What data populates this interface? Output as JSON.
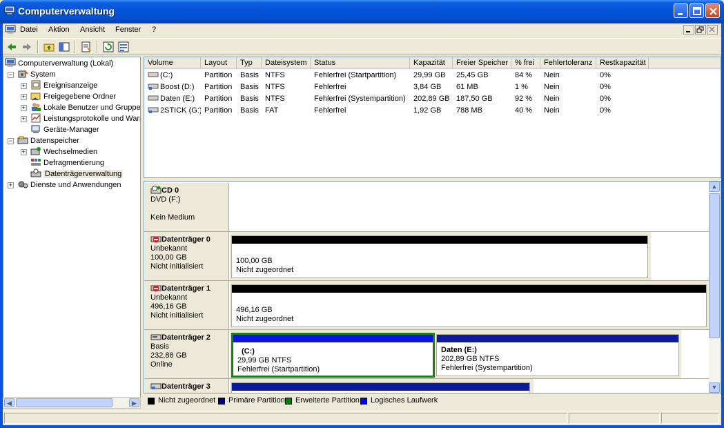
{
  "window": {
    "title": "Computerverwaltung"
  },
  "menu": {
    "items": [
      "Datei",
      "Aktion",
      "Ansicht",
      "Fenster",
      "?"
    ]
  },
  "toolbar": {
    "buttons": [
      "back-icon",
      "forward-icon",
      "up-folder-icon",
      "show-hide-tree-icon",
      "properties-icon",
      "refresh-icon",
      "export-list-icon"
    ]
  },
  "tree": {
    "root": "Computerverwaltung (Lokal)",
    "system": "System",
    "ereignis": "Ereignisanzeige",
    "freigegeben": "Freigegebene Ordner",
    "benutzer": "Lokale Benutzer und Gruppen",
    "leistung": "Leistungsprotokolle und Warnungen",
    "geraete": "Geräte-Manager",
    "datenspeicher": "Datenspeicher",
    "wechselmedien": "Wechselmedien",
    "defrag": "Defragmentierung",
    "datentraeger": "Datenträgerverwaltung",
    "dienste": "Dienste und Anwendungen"
  },
  "list": {
    "columns": [
      "Volume",
      "Layout",
      "Typ",
      "Dateisystem",
      "Status",
      "Kapazität",
      "Freier Speicher",
      "% frei",
      "Fehlertoleranz",
      "Restkapazität"
    ],
    "rows": [
      [
        "(C:)",
        "Partition",
        "Basis",
        "NTFS",
        "Fehlerfrei (Startpartition)",
        "29,99 GB",
        "25,45 GB",
        "84 %",
        "Nein",
        "0%"
      ],
      [
        "Boost (D:)",
        "Partition",
        "Basis",
        "NTFS",
        "Fehlerfrei",
        "3,84 GB",
        "61 MB",
        "1 %",
        "Nein",
        "0%"
      ],
      [
        "Daten (E:)",
        "Partition",
        "Basis",
        "NTFS",
        "Fehlerfrei (Systempartition)",
        "202,89 GB",
        "187,50 GB",
        "92 %",
        "Nein",
        "0%"
      ],
      [
        "2STICK (G:)",
        "Partition",
        "Basis",
        "FAT",
        "Fehlerfrei",
        "1,92 GB",
        "788 MB",
        "40 %",
        "Nein",
        "0%"
      ]
    ]
  },
  "disks": {
    "cd0": {
      "name": "CD 0",
      "line1": "DVD (F:)",
      "line2": "",
      "line3": "Kein Medium"
    },
    "d0": {
      "name": "Datenträger 0",
      "line1": "Unbekannt",
      "line2": "100,00 GB",
      "line3": "Nicht initialisiert",
      "vol_size": "100,00 GB",
      "vol_status": "Nicht zugeordnet"
    },
    "d1": {
      "name": "Datenträger 1",
      "line1": "Unbekannt",
      "line2": "496,16 GB",
      "line3": "Nicht initialisiert",
      "vol_size": "496,16 GB",
      "vol_status": "Nicht zugeordnet"
    },
    "d2": {
      "name": "Datenträger 2",
      "line1": "Basis",
      "line2": "232,88 GB",
      "line3": "Online",
      "vol_c": {
        "title": "(C:)",
        "size": "29,99 GB NTFS",
        "status": "Fehlerfrei (Startpartition)"
      },
      "vol_e": {
        "title": "Daten  (E:)",
        "size": "202,89 GB NTFS",
        "status": "Fehlerfrei (Systempartition)"
      }
    },
    "d3": {
      "name": "Datenträger 3"
    }
  },
  "legend": [
    {
      "label": "Nicht zugeordnet",
      "color": "#000000"
    },
    {
      "label": "Primäre Partition",
      "color": "#000080"
    },
    {
      "label": "Erweiterte Partition",
      "color": "#008000"
    },
    {
      "label": "Logisches Laufwerk",
      "color": "#0000ff"
    }
  ],
  "colors": {
    "primary": "#000080",
    "logical": "#0000ff",
    "extended": "#008000",
    "unallocated": "#000000"
  }
}
